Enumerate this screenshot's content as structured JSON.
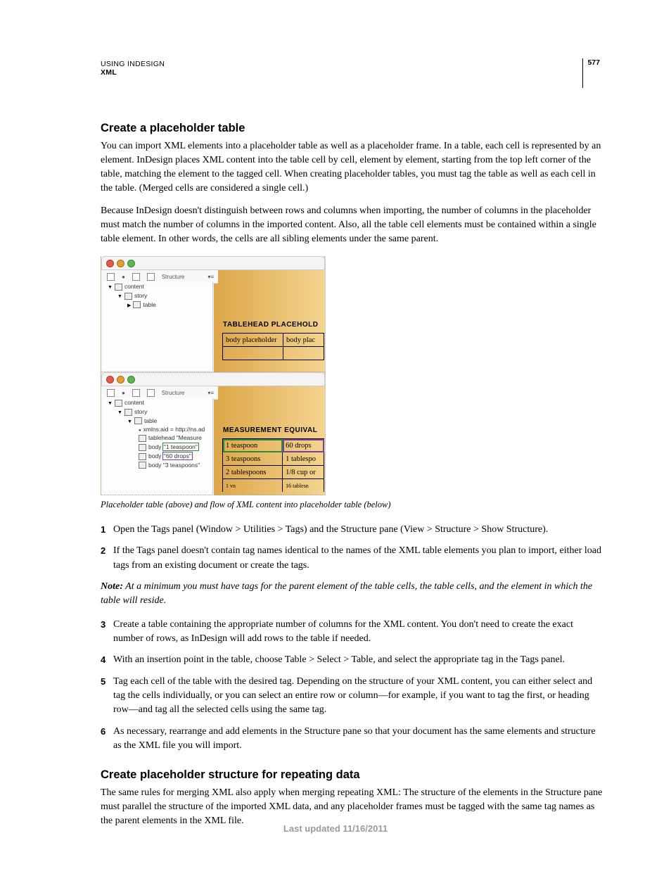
{
  "header": {
    "title": "USING INDESIGN",
    "subtitle": "XML",
    "page_number": "577"
  },
  "section1": {
    "heading": "Create a placeholder table",
    "para1": "You can import XML elements into a placeholder table as well as a placeholder frame. In a table, each cell is represented by an element. InDesign places XML content into the table cell by cell, element by element, starting from the top left corner of the table, matching the element to the tagged cell. When creating placeholder tables, you must tag the table as well as each cell in the table. (Merged cells are considered a single cell.)",
    "para2": "Because InDesign doesn't distinguish between rows and columns when importing, the number of columns in the placeholder must match the number of columns in the imported content. Also, all the table cell elements must be contained within a single table element. In other words, the cells are all sibling elements under the same parent."
  },
  "figure": {
    "toolbar_label": "Structure",
    "top_tree": {
      "n1": "content",
      "n2": "story",
      "n3": "table"
    },
    "top_canvas": {
      "head": "TABLEHEAD PLACEHOLD",
      "r1c1": "body placeholder",
      "r1c2": "body plac"
    },
    "bot_tree": {
      "n1": "content",
      "n2": "story",
      "n3": "table",
      "n4": "xmlns:aid = http://ns.ad",
      "n5a": "tablehead",
      "n5b": "\"Measure",
      "n6a": "body",
      "n6b": "\"1 teaspoon\"",
      "n7a": "body",
      "n7b": "\"60 drops\"",
      "n8a": "body",
      "n8b": "\"3 teaspoons\""
    },
    "bot_canvas": {
      "head": "MEASUREMENT EQUIVAL",
      "r1c1": "1 teaspoon",
      "r1c2": "60 drops",
      "r2c1": "3 teaspoons",
      "r2c2": "1 tablespo",
      "r3c1": "2 tablespoons",
      "r3c2": "1/8 cup or",
      "r4c1": "1 vn",
      "r4c2": "16 tablesn"
    },
    "caption": "Placeholder table (above) and flow of XML content into placeholder table (below)"
  },
  "steps": {
    "s1": "Open the Tags panel (Window > Utilities > Tags) and the Structure pane (View > Structure > Show Structure).",
    "s2": "If the Tags panel doesn't contain tag names identical to the names of the XML table elements you plan to import, either load tags from an existing document or create the tags.",
    "note_label": "Note:",
    "note_text": " At a minimum you must have tags for the parent element of the table cells, the table cells, and the element in which the table will reside.",
    "s3": "Create a table containing the appropriate number of columns for the XML content. You don't need to create the exact number of rows, as InDesign will add rows to the table if needed.",
    "s4": "With an insertion point in the table, choose Table > Select > Table, and select the appropriate tag in the Tags panel.",
    "s5": "Tag each cell of the table with the desired tag. Depending on the structure of your XML content, you can either select and tag the cells individually, or you can select an entire row or column—for example, if you want to tag the first, or heading row—and tag all the selected cells using the same tag.",
    "s6": "As necessary, rearrange and add elements in the Structure pane so that your document has the same elements and structure as the XML file you will import."
  },
  "section2": {
    "heading": "Create placeholder structure for repeating data",
    "para1": "The same rules for merging XML also apply when merging repeating XML: The structure of the elements in the Structure pane must parallel the structure of the imported XML data, and any placeholder frames must be tagged with the same tag names as the parent elements in the XML file."
  },
  "footer": "Last updated 11/16/2011"
}
